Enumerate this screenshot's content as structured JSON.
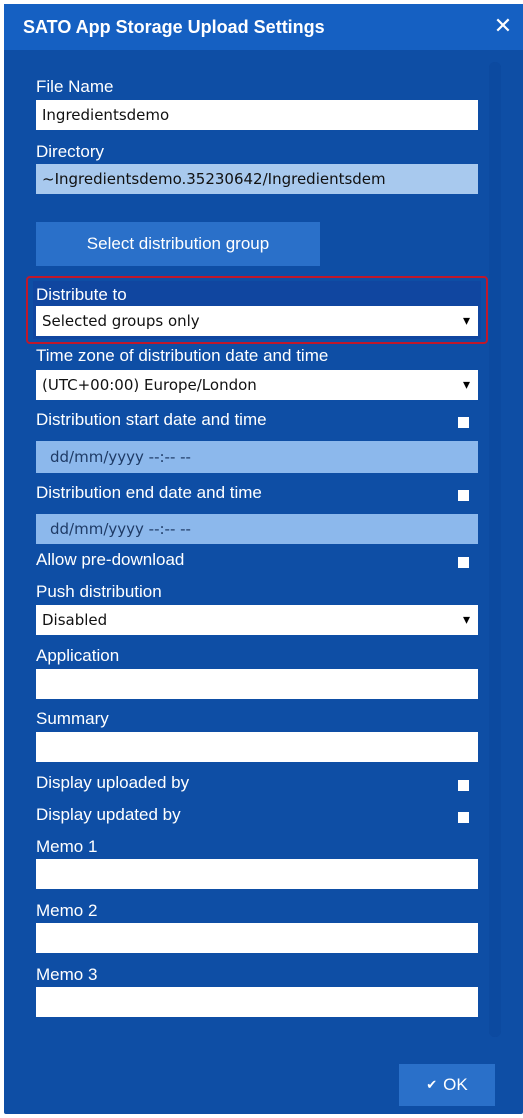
{
  "dialog": {
    "title": "SATO App Storage Upload Settings",
    "close_symbol": "✕"
  },
  "fields": {
    "file_name": {
      "label": "File Name",
      "value": "Ingredientsdemo"
    },
    "directory": {
      "label": "Directory",
      "value": "~Ingredientsdemo.35230642/Ingredientsdem"
    },
    "select_group_button": "Select distribution group",
    "distribute_to": {
      "label": "Distribute to",
      "value": "Selected groups only"
    },
    "timezone": {
      "label": "Time zone of distribution date and time",
      "value": "(UTC+00:00) Europe/London"
    },
    "start": {
      "label": "Distribution start date and time",
      "placeholder": "dd/mm/yyyy --:-- --"
    },
    "end": {
      "label": "Distribution end date and time",
      "placeholder": "dd/mm/yyyy --:-- --"
    },
    "pre_download": {
      "label": "Allow pre-download"
    },
    "push": {
      "label": "Push distribution",
      "value": "Disabled"
    },
    "application": {
      "label": "Application",
      "value": ""
    },
    "summary": {
      "label": "Summary",
      "value": ""
    },
    "display_uploaded_by": {
      "label": "Display uploaded by"
    },
    "display_updated_by": {
      "label": "Display updated by"
    },
    "memo1": {
      "label": "Memo 1",
      "value": ""
    },
    "memo2": {
      "label": "Memo 2",
      "value": ""
    },
    "memo3": {
      "label": "Memo 3",
      "value": ""
    }
  },
  "footer": {
    "ok_label": "OK",
    "ok_icon": "✔"
  },
  "colors": {
    "dialog_bg": "#0e4ea5",
    "titlebar_bg": "#1560c2",
    "button_bg": "#2a70c9",
    "highlight_border": "#c0182b"
  }
}
